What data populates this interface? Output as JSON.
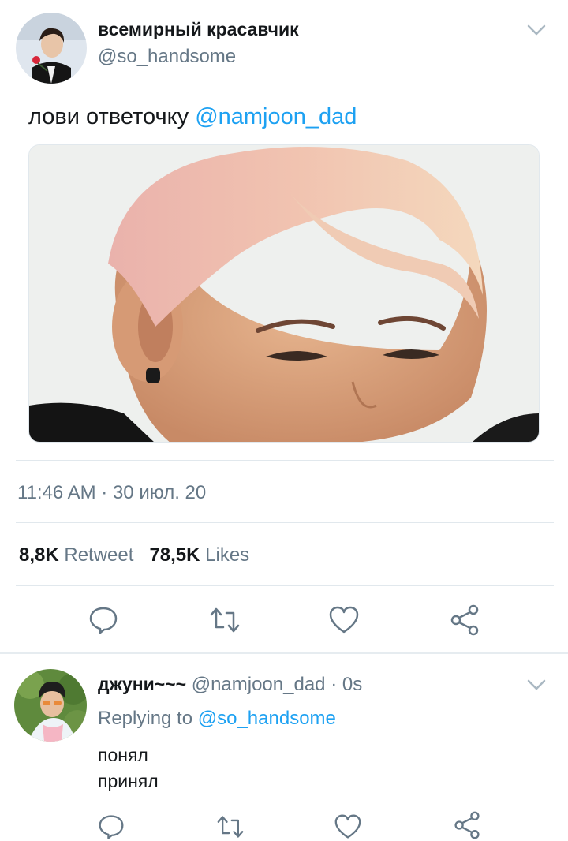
{
  "tweet": {
    "author": {
      "display_name": "всемирный красавчик",
      "handle": "@so_handsome",
      "avatar_icon": "profile-photo-avatar"
    },
    "text": "лови ответочку",
    "mention": "@namjoon_dad",
    "timestamp": "11:46 AM · 30 июл. 20",
    "stats": {
      "retweets_count": "8,8K",
      "retweets_label": "Retweet",
      "likes_count": "78,5K",
      "likes_label": "Likes"
    },
    "actions": [
      "reply-icon",
      "retweet-icon",
      "like-icon",
      "share-icon"
    ]
  },
  "reply": {
    "author": {
      "display_name": "джуни~~~",
      "handle": "@namjoon_dad",
      "time": "· 0s",
      "avatar_icon": "profile-photo-avatar"
    },
    "replying_label": "Replying to",
    "replying_to": "@so_handsome",
    "lines": [
      "понял",
      "принял"
    ],
    "actions": [
      "reply-icon",
      "retweet-icon",
      "like-icon",
      "share-icon"
    ]
  },
  "colors": {
    "link": "#1da1f2",
    "secondary_text": "#657786",
    "primary_text": "#14171a",
    "divider": "#e1e8ed"
  }
}
